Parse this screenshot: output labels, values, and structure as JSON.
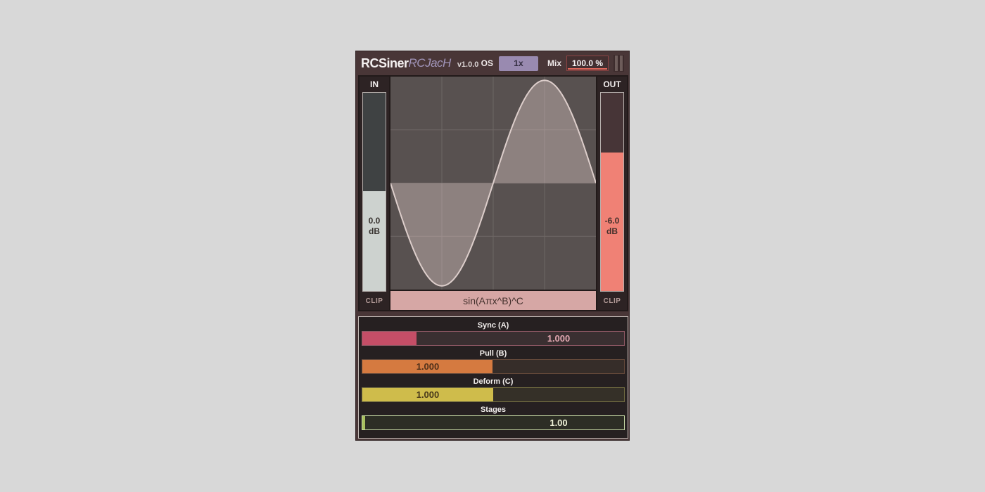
{
  "window": {
    "bg": "#d8d8d8",
    "plugin_bg": "#493637"
  },
  "header": {
    "title": "RCSiner",
    "author": "RCJacH",
    "version": "v1.0.0",
    "os_label": "OS",
    "os_value": "1x",
    "mix_label": "Mix",
    "mix_value": "100.0 %",
    "colors": {
      "os_bg": "#998ab0",
      "os_text": "#332d40",
      "mix_border": "#8c4343",
      "mix_underline": "#e2685c"
    }
  },
  "meters": {
    "input": {
      "label": "IN",
      "value": "0.0",
      "unit": "dB",
      "clip": "CLIP",
      "fill": "50.5%",
      "colors": {
        "track": "#3f4243",
        "fill": "#cdd2cf",
        "text": "#37322f"
      }
    },
    "output": {
      "label": "OUT",
      "value": "-6.0",
      "unit": "dB",
      "clip": "CLIP",
      "fill": "70%",
      "colors": {
        "track": "#473537",
        "fill": "#f08175",
        "text": "#44302c"
      }
    }
  },
  "display": {
    "formula": "sin(Aπx^B)^C",
    "formula_bg": "#d6a7a5"
  },
  "chart_data": {
    "type": "line",
    "title": "sin(Aπx^B)^C",
    "xlabel": "",
    "ylabel": "",
    "x_range": [
      -1,
      1
    ],
    "y_range": [
      -1,
      1
    ],
    "params": {
      "A": 1,
      "B": 1,
      "C": 1
    },
    "amplitude": 0.965,
    "grid": {
      "x_lines": [
        -0.5,
        0,
        0.5
      ],
      "y_lines": [
        -0.5,
        0,
        0.5
      ]
    },
    "key_points": {
      "x": [
        -1,
        -0.75,
        -0.5,
        -0.25,
        0,
        0.25,
        0.5,
        0.75,
        1
      ],
      "y": [
        0,
        -0.707,
        -1,
        -0.707,
        0,
        0.707,
        1,
        0.707,
        0
      ]
    },
    "legend": "none",
    "colors": {
      "bg": "#585150",
      "grid": "#6e6765",
      "line": "#ddcecb",
      "fill": "rgba(228,208,204,0.38)"
    }
  },
  "params": {
    "sliders": [
      {
        "name": "sync",
        "label": "Sync (A)",
        "value": "1.000",
        "fill": "20.6%",
        "value_align": "right",
        "colors": {
          "fill": "#c54e67",
          "border": "#8f5864",
          "track": "#3a2f31",
          "value": "#e2a8b1"
        }
      },
      {
        "name": "pull",
        "label": "Pull (B)",
        "value": "1.000",
        "fill": "49.8%",
        "value_align": "left",
        "colors": {
          "fill": "#d57a40",
          "border": "#64493a",
          "track": "#362d29",
          "value": "#4f301a"
        }
      },
      {
        "name": "deform",
        "label": "Deform (C)",
        "value": "1.000",
        "fill": "50%",
        "value_align": "left",
        "colors": {
          "fill": "#cfbc4b",
          "border": "#716b41",
          "track": "#353028",
          "value": "#48391b"
        }
      },
      {
        "name": "stages",
        "label": "Stages",
        "value": "1.00",
        "fill": "1.2%",
        "value_align": "right",
        "colors": {
          "fill": "#a8bf5e",
          "border": "#c9dca6",
          "track": "#2d2e25",
          "value": "#edf0d6"
        }
      }
    ]
  }
}
